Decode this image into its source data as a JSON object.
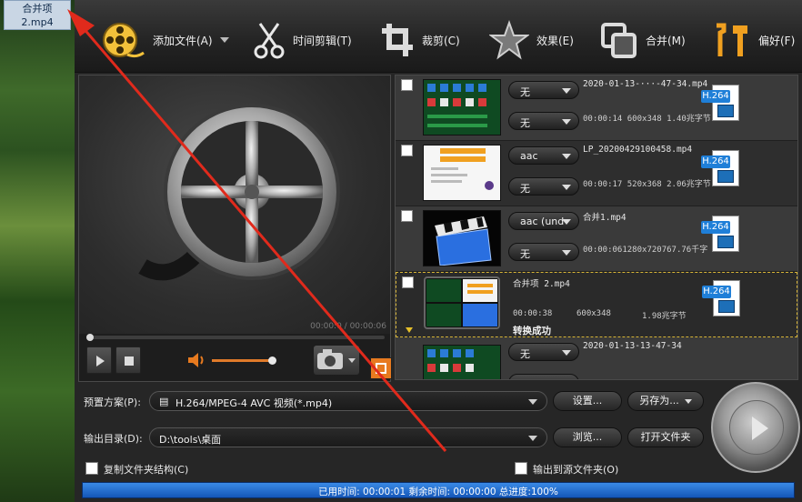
{
  "desktop": {
    "icon_label": "合并项\n2.mp4"
  },
  "toolbar": {
    "add_file": "添加文件(A)",
    "trim": "时间剪辑(T)",
    "crop": "裁剪(C)",
    "effects": "效果(E)",
    "merge": "合并(M)",
    "prefs": "偏好(F)"
  },
  "preview": {
    "time": "00:00:0 / 00:00:06"
  },
  "files": [
    {
      "audio": "无",
      "subtitle": "无",
      "name": "2020-01-13-···-47-34.mp4",
      "meta": "00:00:14 600x348  1.40兆字节",
      "badge": "H.264"
    },
    {
      "audio": "aac",
      "subtitle": "无",
      "name": "LP_20200429100458.mp4",
      "meta": "00:00:17 520x368  2.06兆字节",
      "badge": "H.264"
    },
    {
      "audio": "aac (und",
      "subtitle": "无",
      "name": "合并1.mp4",
      "meta": "00:00:061280x720767.76千字",
      "badge": "H.264"
    },
    {
      "name": "合并项 2.mp4",
      "duration": "00:00:38",
      "resolution": "600x348",
      "size": "1.98兆字节",
      "status": "转换成功",
      "badge": "H.264"
    },
    {
      "audio": "无",
      "name": "2020-01-13-13-47-34"
    }
  ],
  "output": {
    "preset_label": "预置方案(P):",
    "preset_value": "H.264/MPEG-4 AVC 视频(*.mp4)",
    "settings": "设置...",
    "save_as": "另存为...",
    "dir_label": "输出目录(D):",
    "dir_value": "D:\\tools\\桌面",
    "browse": "浏览...",
    "open_folder": "打开文件夹",
    "copy_struct": "复制文件夹结构(C)",
    "to_source": "输出到源文件夹(O)"
  },
  "status": {
    "text": "已用时间: 00:00:01 剩余时间: 00:00:00 总进度:100%"
  },
  "colors": {
    "accent": "#e77a1f",
    "progress": "#1f6ad4",
    "annotation": "#e02a1c"
  }
}
